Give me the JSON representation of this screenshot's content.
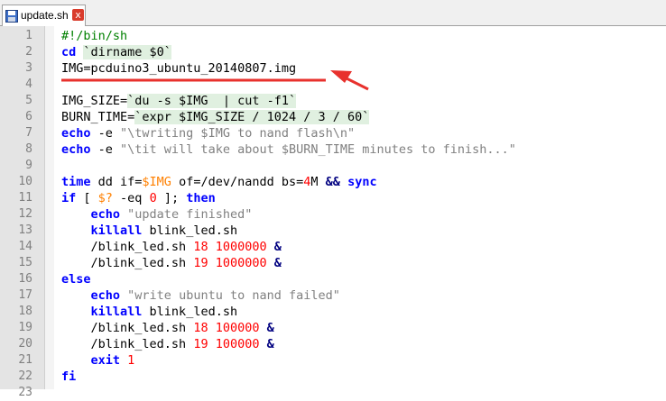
{
  "tab": {
    "label": "update.sh",
    "close_label": "x"
  },
  "lines": [
    {
      "n": "1",
      "segs": [
        [
          "cmt",
          "#!/bin/sh"
        ]
      ]
    },
    {
      "n": "2",
      "segs": [
        [
          "kw",
          "cd"
        ],
        [
          "",
          " "
        ],
        [
          "bt",
          "`dirname $0`"
        ]
      ]
    },
    {
      "n": "3",
      "segs": [
        [
          "",
          "IMG=pcduino3_ubuntu_20140807.img"
        ]
      ]
    },
    {
      "n": "4",
      "segs": []
    },
    {
      "n": "5",
      "segs": [
        [
          "",
          "IMG_SIZE="
        ],
        [
          "bt",
          "`du -s $IMG  | cut -f1`"
        ]
      ]
    },
    {
      "n": "6",
      "segs": [
        [
          "",
          "BURN_TIME="
        ],
        [
          "bt",
          "`expr $IMG_SIZE / 1024 / 3 / 60`"
        ]
      ]
    },
    {
      "n": "7",
      "segs": [
        [
          "kw",
          "echo"
        ],
        [
          "",
          " -e "
        ],
        [
          "str",
          "\"\\twriting $IMG to nand flash\\n\""
        ]
      ]
    },
    {
      "n": "8",
      "segs": [
        [
          "kw",
          "echo"
        ],
        [
          "",
          " -e "
        ],
        [
          "str",
          "\"\\tit will take about $BURN_TIME minutes to finish...\""
        ]
      ]
    },
    {
      "n": "9",
      "segs": []
    },
    {
      "n": "10",
      "segs": [
        [
          "kw",
          "time"
        ],
        [
          "",
          " dd if="
        ],
        [
          "var",
          "$IMG"
        ],
        [
          "",
          " of=/dev/nandd bs="
        ],
        [
          "num",
          "4"
        ],
        [
          "",
          "M "
        ],
        [
          "op",
          "&&"
        ],
        [
          "",
          " "
        ],
        [
          "kw",
          "sync"
        ]
      ]
    },
    {
      "n": "11",
      "segs": [
        [
          "kw",
          "if"
        ],
        [
          "",
          " [ "
        ],
        [
          "var",
          "$?"
        ],
        [
          "",
          " -eq "
        ],
        [
          "num",
          "0"
        ],
        [
          "",
          " ]; "
        ],
        [
          "kw",
          "then"
        ]
      ]
    },
    {
      "n": "12",
      "segs": [
        [
          "",
          "    "
        ],
        [
          "kw",
          "echo"
        ],
        [
          "",
          " "
        ],
        [
          "str",
          "\"update finished\""
        ]
      ]
    },
    {
      "n": "13",
      "segs": [
        [
          "",
          "    "
        ],
        [
          "kw",
          "killall"
        ],
        [
          "",
          " blink_led.sh"
        ]
      ]
    },
    {
      "n": "14",
      "segs": [
        [
          "",
          "    /blink_led.sh "
        ],
        [
          "num",
          "18"
        ],
        [
          "",
          " "
        ],
        [
          "num",
          "1000000"
        ],
        [
          "",
          " "
        ],
        [
          "op",
          "&"
        ]
      ]
    },
    {
      "n": "15",
      "segs": [
        [
          "",
          "    /blink_led.sh "
        ],
        [
          "num",
          "19"
        ],
        [
          "",
          " "
        ],
        [
          "num",
          "1000000"
        ],
        [
          "",
          " "
        ],
        [
          "op",
          "&"
        ]
      ]
    },
    {
      "n": "16",
      "segs": [
        [
          "kw",
          "else"
        ]
      ]
    },
    {
      "n": "17",
      "segs": [
        [
          "",
          "    "
        ],
        [
          "kw",
          "echo"
        ],
        [
          "",
          " "
        ],
        [
          "str",
          "\"write ubuntu to nand failed\""
        ]
      ]
    },
    {
      "n": "18",
      "segs": [
        [
          "",
          "    "
        ],
        [
          "kw",
          "killall"
        ],
        [
          "",
          " blink_led.sh"
        ]
      ]
    },
    {
      "n": "19",
      "segs": [
        [
          "",
          "    /blink_led.sh "
        ],
        [
          "num",
          "18"
        ],
        [
          "",
          " "
        ],
        [
          "num",
          "100000"
        ],
        [
          "",
          " "
        ],
        [
          "op",
          "&"
        ]
      ]
    },
    {
      "n": "20",
      "segs": [
        [
          "",
          "    /blink_led.sh "
        ],
        [
          "num",
          "19"
        ],
        [
          "",
          " "
        ],
        [
          "num",
          "100000"
        ],
        [
          "",
          " "
        ],
        [
          "op",
          "&"
        ]
      ]
    },
    {
      "n": "21",
      "segs": [
        [
          "",
          "    "
        ],
        [
          "kw",
          "exit"
        ],
        [
          "",
          " "
        ],
        [
          "num",
          "1"
        ]
      ]
    },
    {
      "n": "22",
      "segs": [
        [
          "kw",
          "fi"
        ]
      ]
    },
    {
      "n": "23",
      "segs": []
    }
  ],
  "colors": {
    "annotation": "#e8312d",
    "keyword": "#0000ff",
    "comment": "#008000",
    "string": "#808080",
    "number": "#ff0000",
    "variable": "#ff8000",
    "backtick_bg": "#e0f0e0"
  },
  "icons": {
    "tab_file": "floppy-disk-icon",
    "tab_close": "close-icon"
  }
}
